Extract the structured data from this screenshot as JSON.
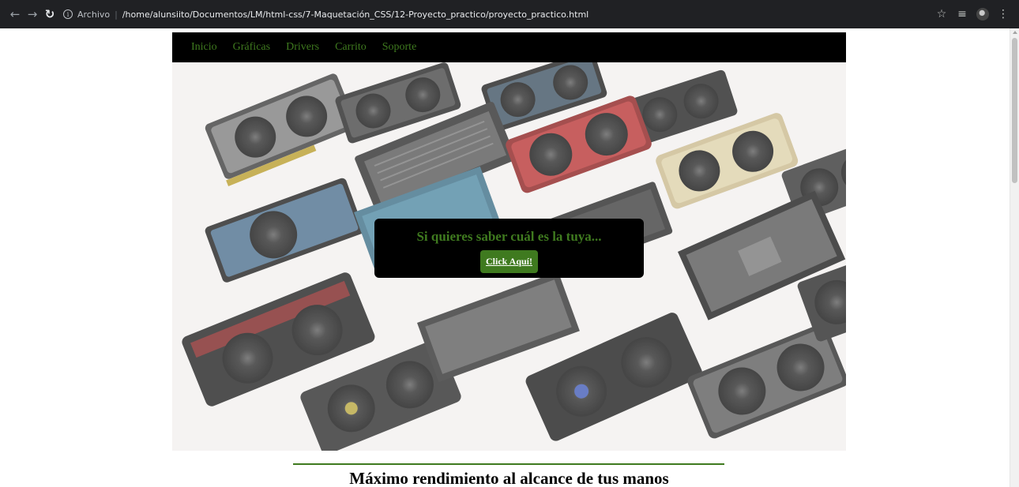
{
  "browser": {
    "scheme_label": "Archivo",
    "url": "/home/alunsiito/Documentos/LM/html-css/7-Maquetación_CSS/12-Proyecto_practico/proyecto_practico.html"
  },
  "site": {
    "nav": [
      "Inicio",
      "Gráficas",
      "Drivers",
      "Carrito",
      "Soporte"
    ],
    "cta_text": "Si quieres saber cuál es la tuya...",
    "cta_button": "Click Aquí!",
    "tagline": "Máximo rendimiento al alcance de tus manos",
    "accent_color": "#3f7a1f"
  }
}
